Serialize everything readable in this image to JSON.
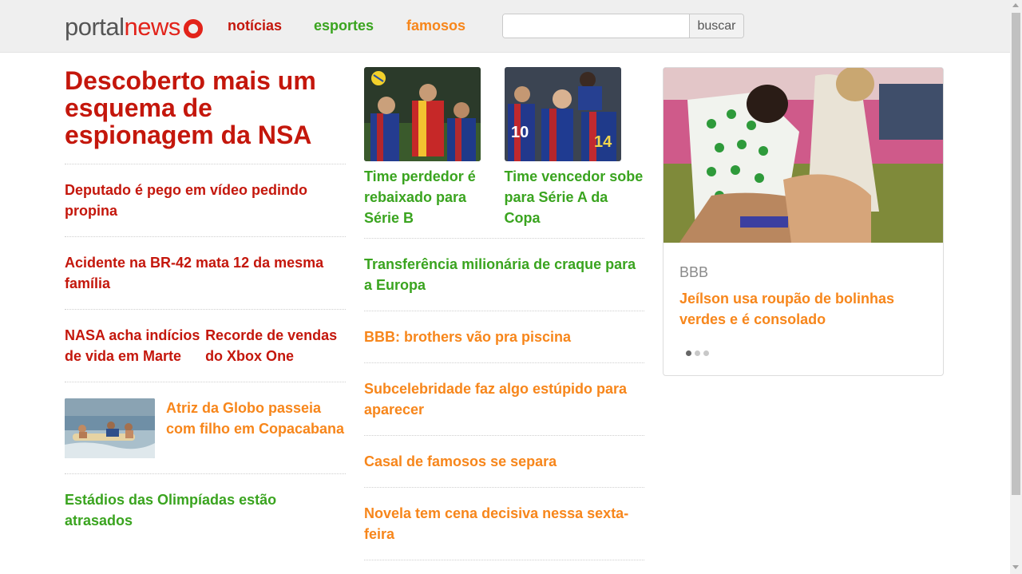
{
  "header": {
    "logo_part1": "portal",
    "logo_part2": "news",
    "nav": [
      "notícias",
      "esportes",
      "famosos"
    ],
    "search_placeholder": "",
    "search_button": "buscar"
  },
  "colors": {
    "noticias": "#c4170c",
    "esportes": "#3aa41f",
    "famosos": "#f7861b"
  },
  "col1": {
    "headline": "Descoberto mais um esquema de espionagem da NSA",
    "items": [
      "Deputado é pego em vídeo pedindo propina",
      "Acidente na BR-42 mata 12 da mesma família"
    ],
    "pair": [
      "NASA acha indícios de vida em Marte",
      "Recorde de vendas do Xbox One"
    ],
    "with_image": "Atriz da Globo passeia com filho em Copacabana",
    "last": "Estádios das Olimpíadas estão atrasados"
  },
  "col2": {
    "images": [
      {
        "caption": "Time perdedor é rebaixado para Série B"
      },
      {
        "caption": "Time vencedor sobe para Série A da Copa"
      }
    ],
    "green_items": [
      "Transferência milionária de craque para a Europa"
    ],
    "orange_items": [
      "BBB: brothers vão pra piscina",
      "Subcelebridade faz algo estúpido para aparecer",
      "Casal de famosos se separa",
      "Novela tem cena decisiva nessa sexta-feira"
    ]
  },
  "card": {
    "label": "BBB",
    "title": "Jeílson usa roupão de bolinhas verdes e é consolado",
    "slides": 3,
    "active_slide": 1
  }
}
